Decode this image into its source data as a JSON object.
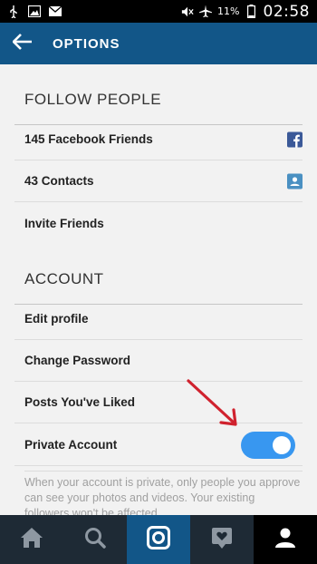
{
  "status_bar": {
    "battery_percent": "11%",
    "time": "02:58"
  },
  "action_bar": {
    "title": "OPTIONS"
  },
  "follow_people": {
    "header": "FOLLOW PEOPLE",
    "items": [
      {
        "label": "145 Facebook Friends",
        "icon": "facebook-icon"
      },
      {
        "label": "43 Contacts",
        "icon": "contacts-icon"
      },
      {
        "label": "Invite Friends"
      }
    ]
  },
  "account": {
    "header": "ACCOUNT",
    "items": [
      {
        "label": "Edit profile"
      },
      {
        "label": "Change Password"
      },
      {
        "label": "Posts You've Liked"
      },
      {
        "label": "Private Account",
        "toggle_on": true
      }
    ],
    "private_description": "When your account is private, only people you approve can see your photos and videos. Your existing followers won't be affected."
  },
  "colors": {
    "action_bar": "#125688",
    "toggle_on": "#3897f0",
    "nav_bg": "#1e2a35",
    "arrow": "#d0222e"
  },
  "bottom_nav": [
    "home-icon",
    "search-icon",
    "camera-icon",
    "activity-icon",
    "profile-icon"
  ]
}
